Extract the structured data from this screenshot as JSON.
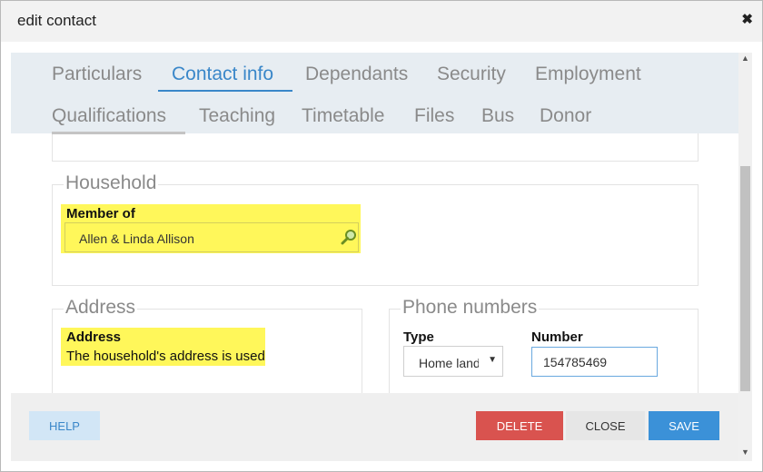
{
  "dialog": {
    "title": "edit contact"
  },
  "tabs": {
    "row1": [
      "Particulars",
      "Contact info",
      "Dependants",
      "Security",
      "Employment"
    ],
    "row2": [
      "Qualifications",
      "Teaching",
      "Timetable",
      "Files",
      "Bus",
      "Donor"
    ],
    "active": "Contact info"
  },
  "household": {
    "legend": "Household",
    "member_label": "Member of",
    "member_value": "Allen & Linda Allison"
  },
  "address": {
    "legend": "Address",
    "label": "Address",
    "text": "The household's address is used"
  },
  "phone": {
    "legend": "Phone numbers",
    "type_label": "Type",
    "type_value": "Home landline",
    "number_label": "Number",
    "number_value": "154785469"
  },
  "footer": {
    "help": "HELP",
    "delete": "DELETE",
    "close": "CLOSE",
    "save": "SAVE"
  },
  "colors": {
    "highlight": "#fff75a",
    "accent": "#3a87c9",
    "delete": "#d9534f",
    "save": "#3b91d8"
  },
  "icons": {
    "close": "close-icon",
    "lookup": "search-icon",
    "dropdown": "chevron-down-icon"
  }
}
